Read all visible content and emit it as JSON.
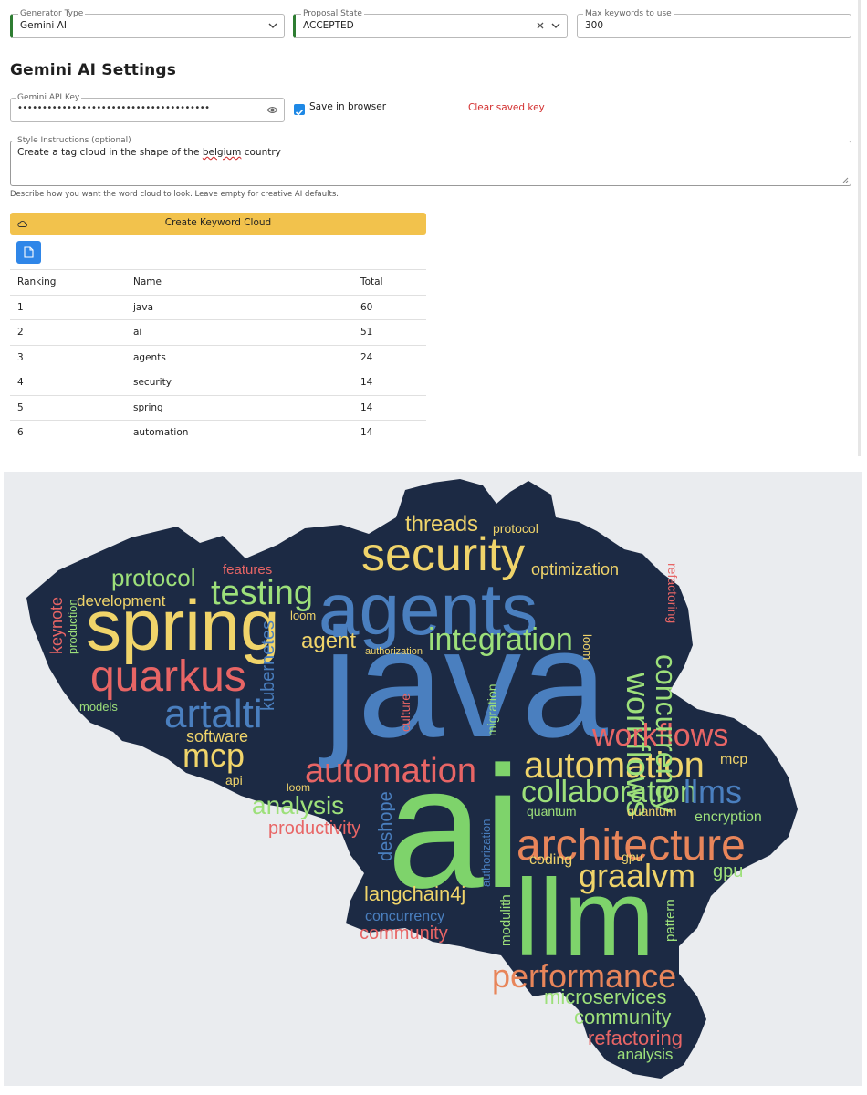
{
  "top_bar": {
    "generator_type": {
      "label": "Generator Type",
      "value": "Gemini AI"
    },
    "proposal_state": {
      "label": "Proposal State",
      "value": "ACCEPTED"
    },
    "max_keywords": {
      "label": "Max keywords to use",
      "value": "300"
    }
  },
  "settings": {
    "title": "Gemini AI Settings",
    "api_key": {
      "label": "Gemini API Key",
      "value": "•••••••••••••••••••••••••••••••••••••••"
    },
    "save_in_browser": {
      "label": "Save in browser",
      "checked": true
    },
    "clear_saved_key": "Clear saved key",
    "style_instructions": {
      "label": "Style Instructions (optional)",
      "value_before": "Create a tag cloud in the shape of the ",
      "value_misspelled": "belgium",
      "value_after": " country",
      "helper": "Describe how you want the word cloud to look. Leave empty for creative AI defaults."
    },
    "create_button": "Create Keyword Cloud",
    "accent_color": "#f2c24c",
    "file_button_color": "#2f86e8"
  },
  "table": {
    "headers": [
      "Ranking",
      "Name",
      "Total"
    ],
    "rows": [
      [
        "1",
        "java",
        "60"
      ],
      [
        "2",
        "ai",
        "51"
      ],
      [
        "3",
        "agents",
        "24"
      ],
      [
        "4",
        "security",
        "14"
      ],
      [
        "5",
        "spring",
        "14"
      ],
      [
        "6",
        "automation",
        "14"
      ]
    ]
  },
  "cloud": {
    "background": "#1c2a44",
    "words": [
      {
        "t": "java",
        "c": "#4a7fbf"
      },
      {
        "t": "ai",
        "c": "#7ed36b"
      },
      {
        "t": "agents",
        "c": "#4a7fbf"
      },
      {
        "t": "spring",
        "c": "#f0d46a"
      },
      {
        "t": "llm",
        "c": "#7ed36b"
      },
      {
        "t": "security",
        "c": "#f0d46a"
      },
      {
        "t": "architecture",
        "c": "#e8855a"
      },
      {
        "t": "quarkus",
        "c": "#e86565"
      },
      {
        "t": "automation",
        "c": "#f0d46a"
      },
      {
        "t": "automation",
        "c": "#e86565"
      },
      {
        "t": "testing",
        "c": "#9de07a"
      },
      {
        "t": "workflows",
        "c": "#9de07a"
      },
      {
        "t": "workflows",
        "c": "#e86565"
      },
      {
        "t": "concurrency",
        "c": "#9de07a"
      },
      {
        "t": "integration",
        "c": "#9de07a"
      },
      {
        "t": "collaboration",
        "c": "#9de07a"
      },
      {
        "t": "graalvm",
        "c": "#f0d46a"
      },
      {
        "t": "performance",
        "c": "#e8855a"
      },
      {
        "t": "mcp",
        "c": "#f0d46a"
      },
      {
        "t": "artalti",
        "c": "#4a7fbf"
      },
      {
        "t": "llms",
        "c": "#4a7fbf"
      },
      {
        "t": "analysis",
        "c": "#9de07a"
      },
      {
        "t": "protocol",
        "c": "#9de07a"
      },
      {
        "t": "threads",
        "c": "#f0d46a"
      },
      {
        "t": "optimization",
        "c": "#f0d46a"
      },
      {
        "t": "langchain4j",
        "c": "#f0d46a"
      },
      {
        "t": "microservices",
        "c": "#9de07a"
      },
      {
        "t": "community",
        "c": "#9de07a"
      },
      {
        "t": "refactoring",
        "c": "#e86565"
      },
      {
        "t": "community",
        "c": "#e86565"
      },
      {
        "t": "productivity",
        "c": "#e86565"
      },
      {
        "t": "development",
        "c": "#f0d46a"
      },
      {
        "t": "software",
        "c": "#f0d46a"
      },
      {
        "t": "agent",
        "c": "#f0d46a"
      },
      {
        "t": "kubernetes",
        "c": "#4a7fbf"
      },
      {
        "t": "deshope",
        "c": "#4a7fbf"
      },
      {
        "t": "features",
        "c": "#e86565"
      },
      {
        "t": "keynote",
        "c": "#e86565"
      },
      {
        "t": "production",
        "c": "#9de07a"
      },
      {
        "t": "models",
        "c": "#9de07a"
      },
      {
        "t": "api",
        "c": "#f0d46a"
      },
      {
        "t": "loom",
        "c": "#f0d46a"
      },
      {
        "t": "loom",
        "c": "#f0d46a"
      },
      {
        "t": "loom",
        "c": "#f0d46a"
      },
      {
        "t": "culture",
        "c": "#e86565"
      },
      {
        "t": "migration",
        "c": "#9de07a"
      },
      {
        "t": "authorization",
        "c": "#f0d46a"
      },
      {
        "t": "authorization",
        "c": "#4a7fbf"
      },
      {
        "t": "quantum",
        "c": "#9de07a"
      },
      {
        "t": "quantum",
        "c": "#f0d46a"
      },
      {
        "t": "encryption",
        "c": "#9de07a"
      },
      {
        "t": "coding",
        "c": "#f0d46a"
      },
      {
        "t": "gpu",
        "c": "#f0d46a"
      },
      {
        "t": "gpu",
        "c": "#9de07a"
      },
      {
        "t": "mcp",
        "c": "#f0d46a"
      },
      {
        "t": "concurrency",
        "c": "#4a7fbf"
      },
      {
        "t": "modulith",
        "c": "#9de07a"
      },
      {
        "t": "pattern",
        "c": "#9de07a"
      },
      {
        "t": "analysis",
        "c": "#9de07a"
      },
      {
        "t": "refactoring",
        "c": "#e86565"
      },
      {
        "t": "protocol",
        "c": "#f0d46a"
      }
    ]
  }
}
